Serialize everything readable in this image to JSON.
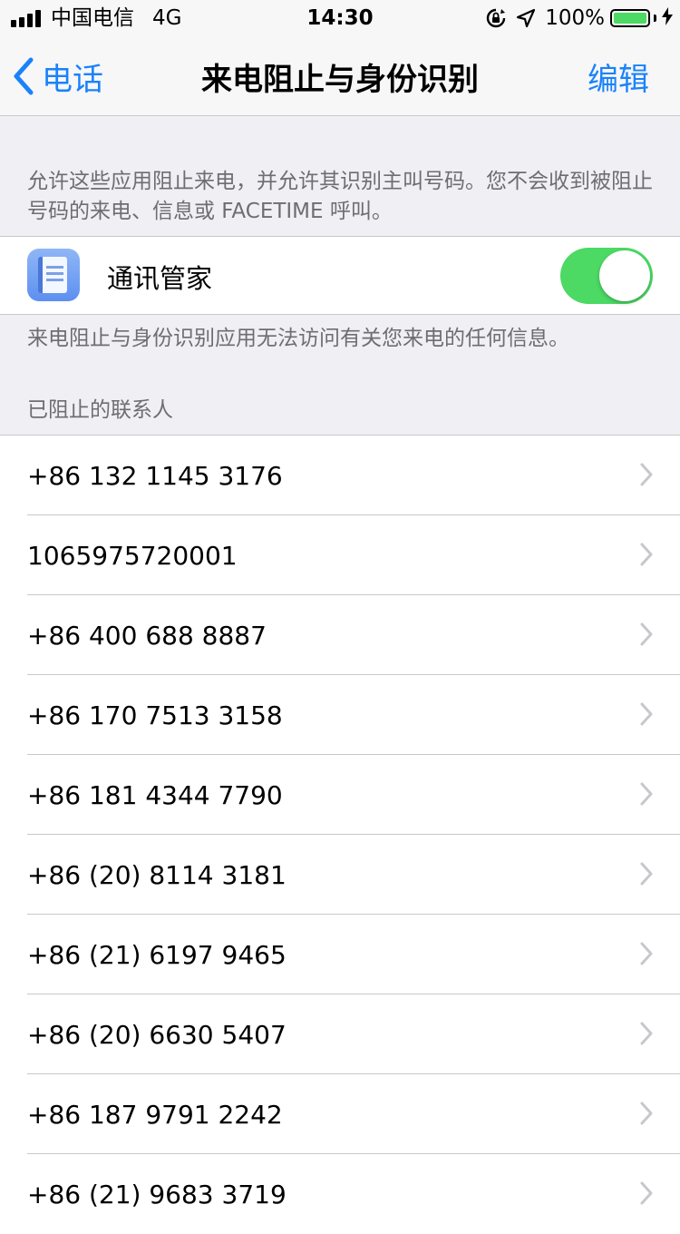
{
  "status_bar": {
    "carrier": "中国电信",
    "network": "4G",
    "time": "14:30",
    "battery_percent": "100%",
    "battery_level": 1.0,
    "battery_color": "#4cd964"
  },
  "nav": {
    "back_label": "电话",
    "title": "来电阻止与身份识别",
    "edit_label": "编辑",
    "accent_color": "#1a82fb"
  },
  "intro_text": "允许这些应用阻止来电，并允许其识别主叫号码。您不会收到被阻止号码的来电、信息或 FACETIME 呼叫。",
  "app": {
    "name": "通讯管家",
    "icon": "address-book-icon",
    "enabled": true,
    "toggle_color": "#4cd964"
  },
  "privacy_note": "来电阻止与身份识别应用无法访问有关您来电的任何信息。",
  "blocked_header": "已阻止的联系人",
  "blocked_contacts": [
    "+86 132 1145 3176",
    "1065975720001",
    "+86 400 688 8887",
    "+86 170 7513 3158",
    "+86 181 4344 7790",
    "+86 (20) 8114 3181",
    "+86 (21) 6197 9465",
    "+86 (20) 6630 5407",
    "+86 187 9791 2242",
    "+86 (21) 9683 3719"
  ]
}
